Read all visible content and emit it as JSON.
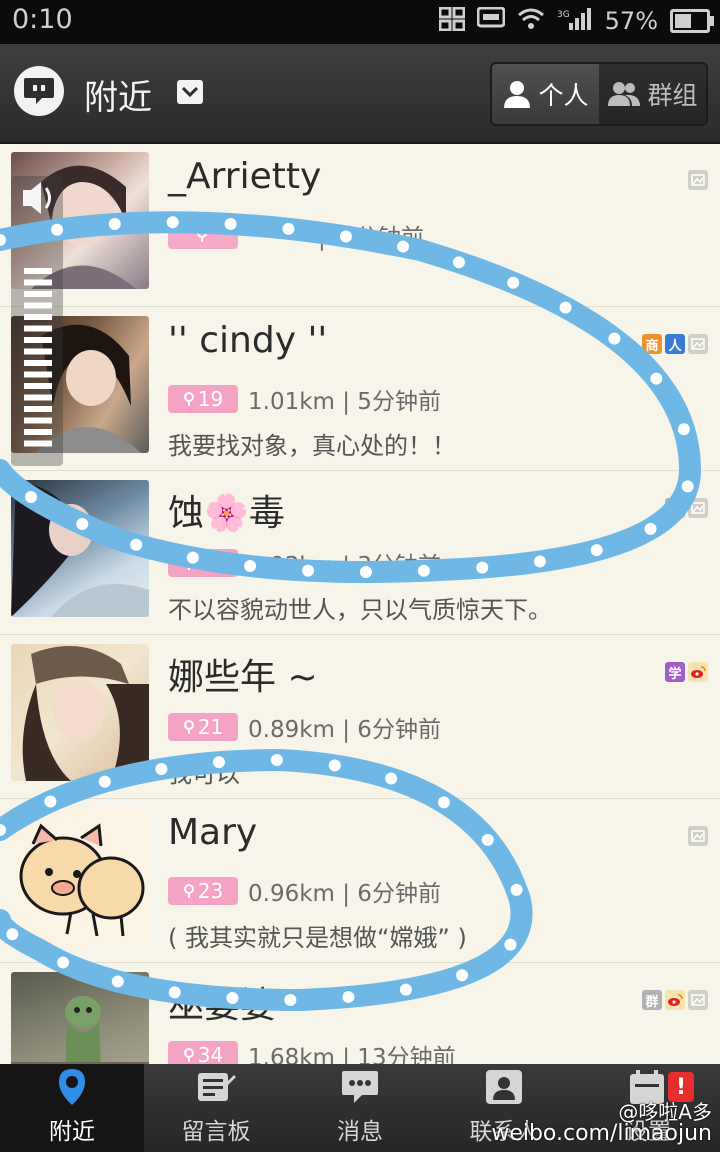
{
  "status_bar": {
    "time": "0:10",
    "network": "3G",
    "battery": "57%",
    "battery_level": 0.57
  },
  "header": {
    "title": "附近",
    "segments": [
      {
        "label": "个人",
        "active": true
      },
      {
        "label": "群组",
        "active": false
      }
    ]
  },
  "users": [
    {
      "name": "_Arrietty",
      "age": "",
      "distance_time": "|11分钟前",
      "signature": "",
      "tags": [
        "photo"
      ]
    },
    {
      "name": "'' cindy ''",
      "age": "19",
      "distance_time": "1.01km | 5分钟前",
      "signature": "我要找对象，真心处的！！",
      "tags": [
        "shang",
        "ren",
        "photo"
      ]
    },
    {
      "name": "蚀🌸毒",
      "age": "21",
      "distance_time": "0.93km | 3分钟前",
      "signature": "不以容貌动世人，只以气质惊天下。",
      "tags": [
        "qun",
        "photo"
      ]
    },
    {
      "name": "娜些年 ~",
      "age": "21",
      "distance_time": "0.89km | 6分钟前",
      "signature": "我可以",
      "tags": [
        "xue",
        "weibo"
      ]
    },
    {
      "name": "Mary",
      "age": "23",
      "distance_time": "0.96km | 6分钟前",
      "signature": "( 我其实就只是想做“嫦娥” )",
      "tags": [
        "photo"
      ]
    },
    {
      "name": "巫婆婆",
      "age": "34",
      "distance_time": "1.68km | 13分钟前",
      "signature": "",
      "tags": [
        "qun",
        "weibo",
        "photo"
      ]
    }
  ],
  "tag_labels": {
    "shang": "商",
    "ren": "人",
    "qun": "群",
    "xue": "学"
  },
  "tabs": [
    {
      "label": "附近",
      "icon": "location-pin-icon",
      "active": true
    },
    {
      "label": "留言板",
      "icon": "message-board-icon",
      "active": false
    },
    {
      "label": "消息",
      "icon": "chat-bubble-icon",
      "active": false
    },
    {
      "label": "联系人",
      "icon": "contacts-icon",
      "active": false
    },
    {
      "label": "设置",
      "icon": "settings-icon",
      "active": false,
      "badge": "!"
    }
  ],
  "watermark": {
    "line1": "@哆啦A多",
    "line2": "weibo.com/limaojun"
  },
  "colors": {
    "accent": "#f5a3c4",
    "header_bg": "#333333",
    "list_bg": "#f7f5e9",
    "marker": "#6fb8e6"
  }
}
